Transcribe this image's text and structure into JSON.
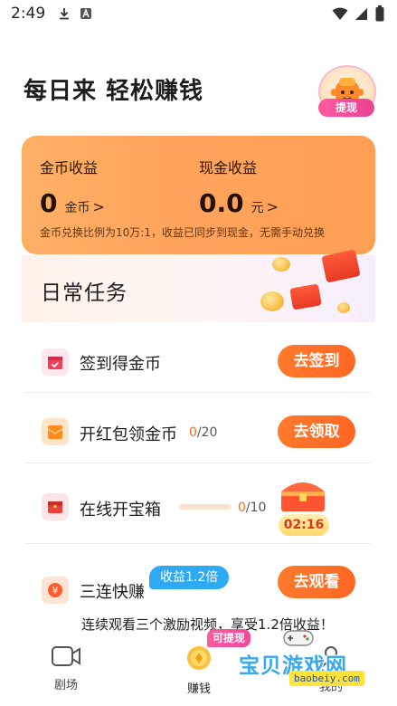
{
  "status_bar": {
    "time": "2:49",
    "icons": [
      "download-icon",
      "a-box-icon",
      "wifi-icon",
      "signal-icon",
      "battery-icon"
    ]
  },
  "header": {
    "title": "每日来 轻松赚钱",
    "withdraw_label": "提现"
  },
  "earnings": {
    "coin_label": "金币收益",
    "coin_value": "0",
    "coin_unit": "金币",
    "cash_label": "现金收益",
    "cash_value": "0.0",
    "cash_unit": "元",
    "chevron": ">",
    "note": "金币兑换比例为10万:1，收益已同步到现金，无需手动兑换"
  },
  "daily": {
    "title": "日常任务"
  },
  "tasks": [
    {
      "name": "签到得金币",
      "button": "去签到",
      "icon": "calendar-icon"
    },
    {
      "name": "开红包领金币",
      "progress_done": "0",
      "progress_total": "/20",
      "button": "去领取",
      "icon": "red-envelope-icon"
    },
    {
      "name": "在线开宝箱",
      "progress_done": "0",
      "progress_total": "/10",
      "progress_fraction": 0.0,
      "timer": "02:16",
      "icon": "treasure-box-icon"
    },
    {
      "name": "三连快赚",
      "button": "去观看",
      "bonus": "收益1.2倍",
      "icon": "yuan-coin-icon",
      "promo": "连续观看三个激励视频，享受1.2倍收益！"
    }
  ],
  "bottom_nav": {
    "items": [
      {
        "label": "剧场",
        "icon": "video-camera-icon"
      },
      {
        "label": "赚钱",
        "icon": "gold-coin-icon",
        "active": true,
        "pill": "可提现"
      },
      {
        "label": "我的",
        "icon": "user-icon"
      }
    ]
  },
  "watermark": {
    "text": "宝贝游戏网",
    "sub": "baobeiy.com"
  },
  "colors": {
    "accent": "#ff6f26",
    "card": "#ffa75e",
    "bonus_blue": "#2ea9f3",
    "pink": "#ef4a96"
  }
}
